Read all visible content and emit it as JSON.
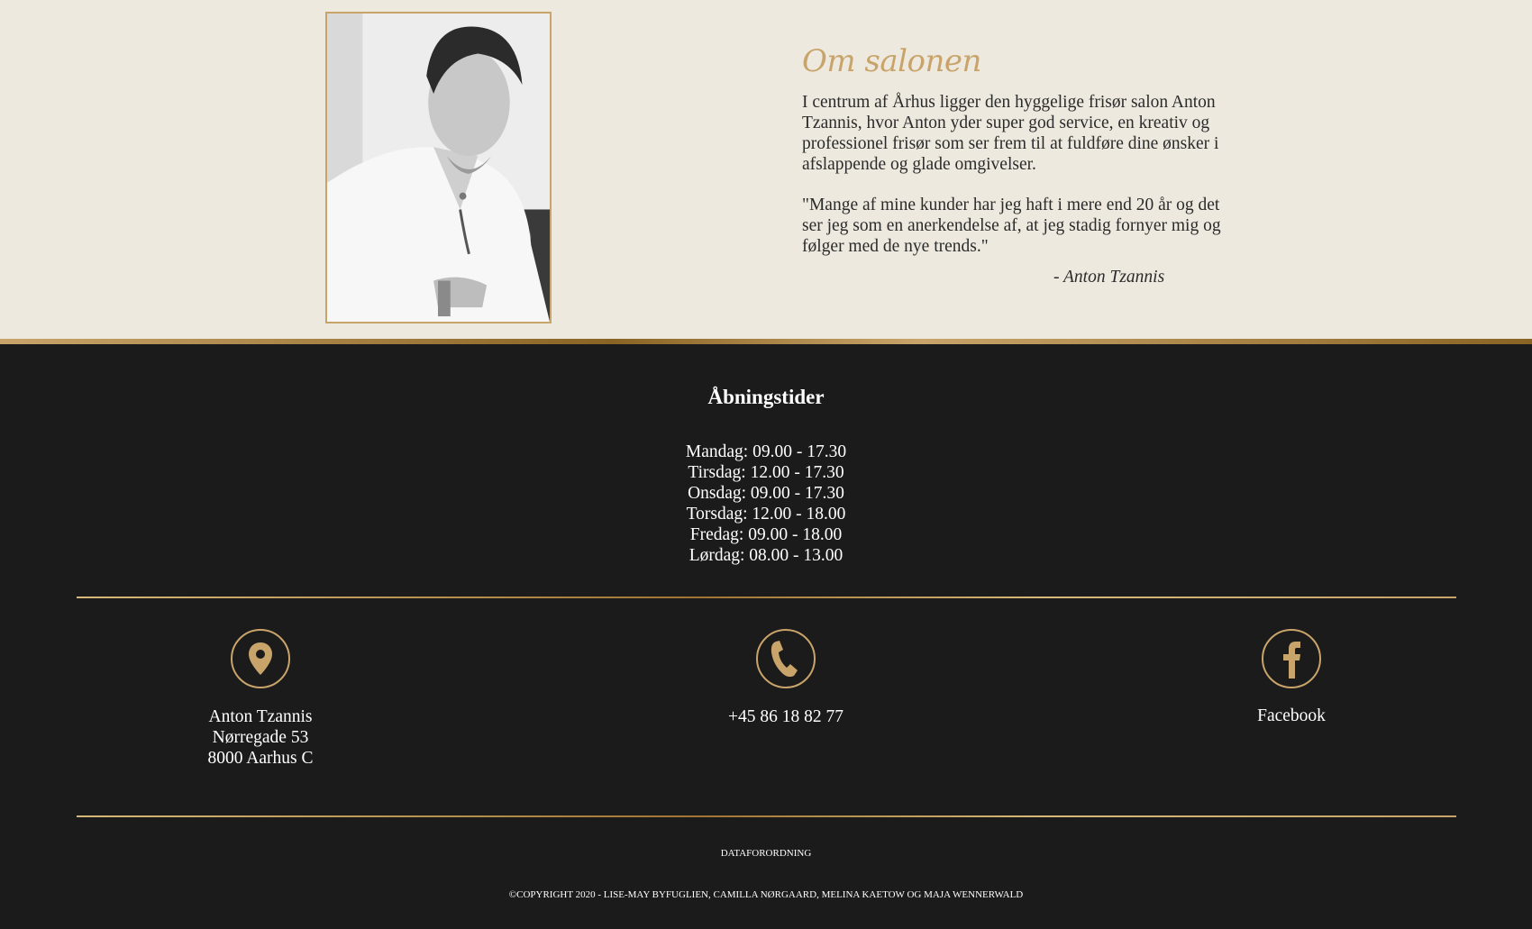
{
  "about": {
    "title": "Om salonen",
    "paragraph1": "I centrum af Århus ligger den hyggelige frisør salon Anton Tzannis, hvor Anton yder super god service, en kreativ og professionel frisør som ser frem til at fuldføre dine ønsker i afslappende og glade omgivelser.",
    "quote": "\"Mange af mine kunder har jeg haft i mere end 20 år og det ser jeg som en anerkendelse af, at jeg stadig fornyer mig og følger med de nye trends.\"",
    "signature": "- Anton Tzannis"
  },
  "hours": {
    "title": "Åbningstider",
    "days": [
      "Mandag: 09.00 - 17.30",
      "Tirsdag: 12.00 - 17.30",
      "Onsdag: 09.00 - 17.30",
      "Torsdag: 12.00 - 18.00",
      "Fredag: 09.00 - 18.00",
      "Lørdag: 08.00 - 13.00"
    ]
  },
  "contact": {
    "address": {
      "icon": "location-pin-icon",
      "line1": "Anton Tzannis",
      "line2": "Nørregade 53",
      "line3": "8000 Aarhus C"
    },
    "phone": {
      "icon": "phone-icon",
      "number": "+45 86 18 82 77"
    },
    "facebook": {
      "icon": "facebook-icon",
      "label": "Facebook"
    }
  },
  "footer": {
    "privacy_link": "DATAFORORDNING",
    "copyright": "©COPYRIGHT 2020 - LISE-MAY BYFUGLIEN, CAMILLA NØRGAARD, MELINA KAETOW OG MAJA WENNERWALD"
  },
  "colors": {
    "accent_gold": "#c9a46a",
    "cream_bg": "#eee9df",
    "footer_bg": "#1b1b1b"
  }
}
